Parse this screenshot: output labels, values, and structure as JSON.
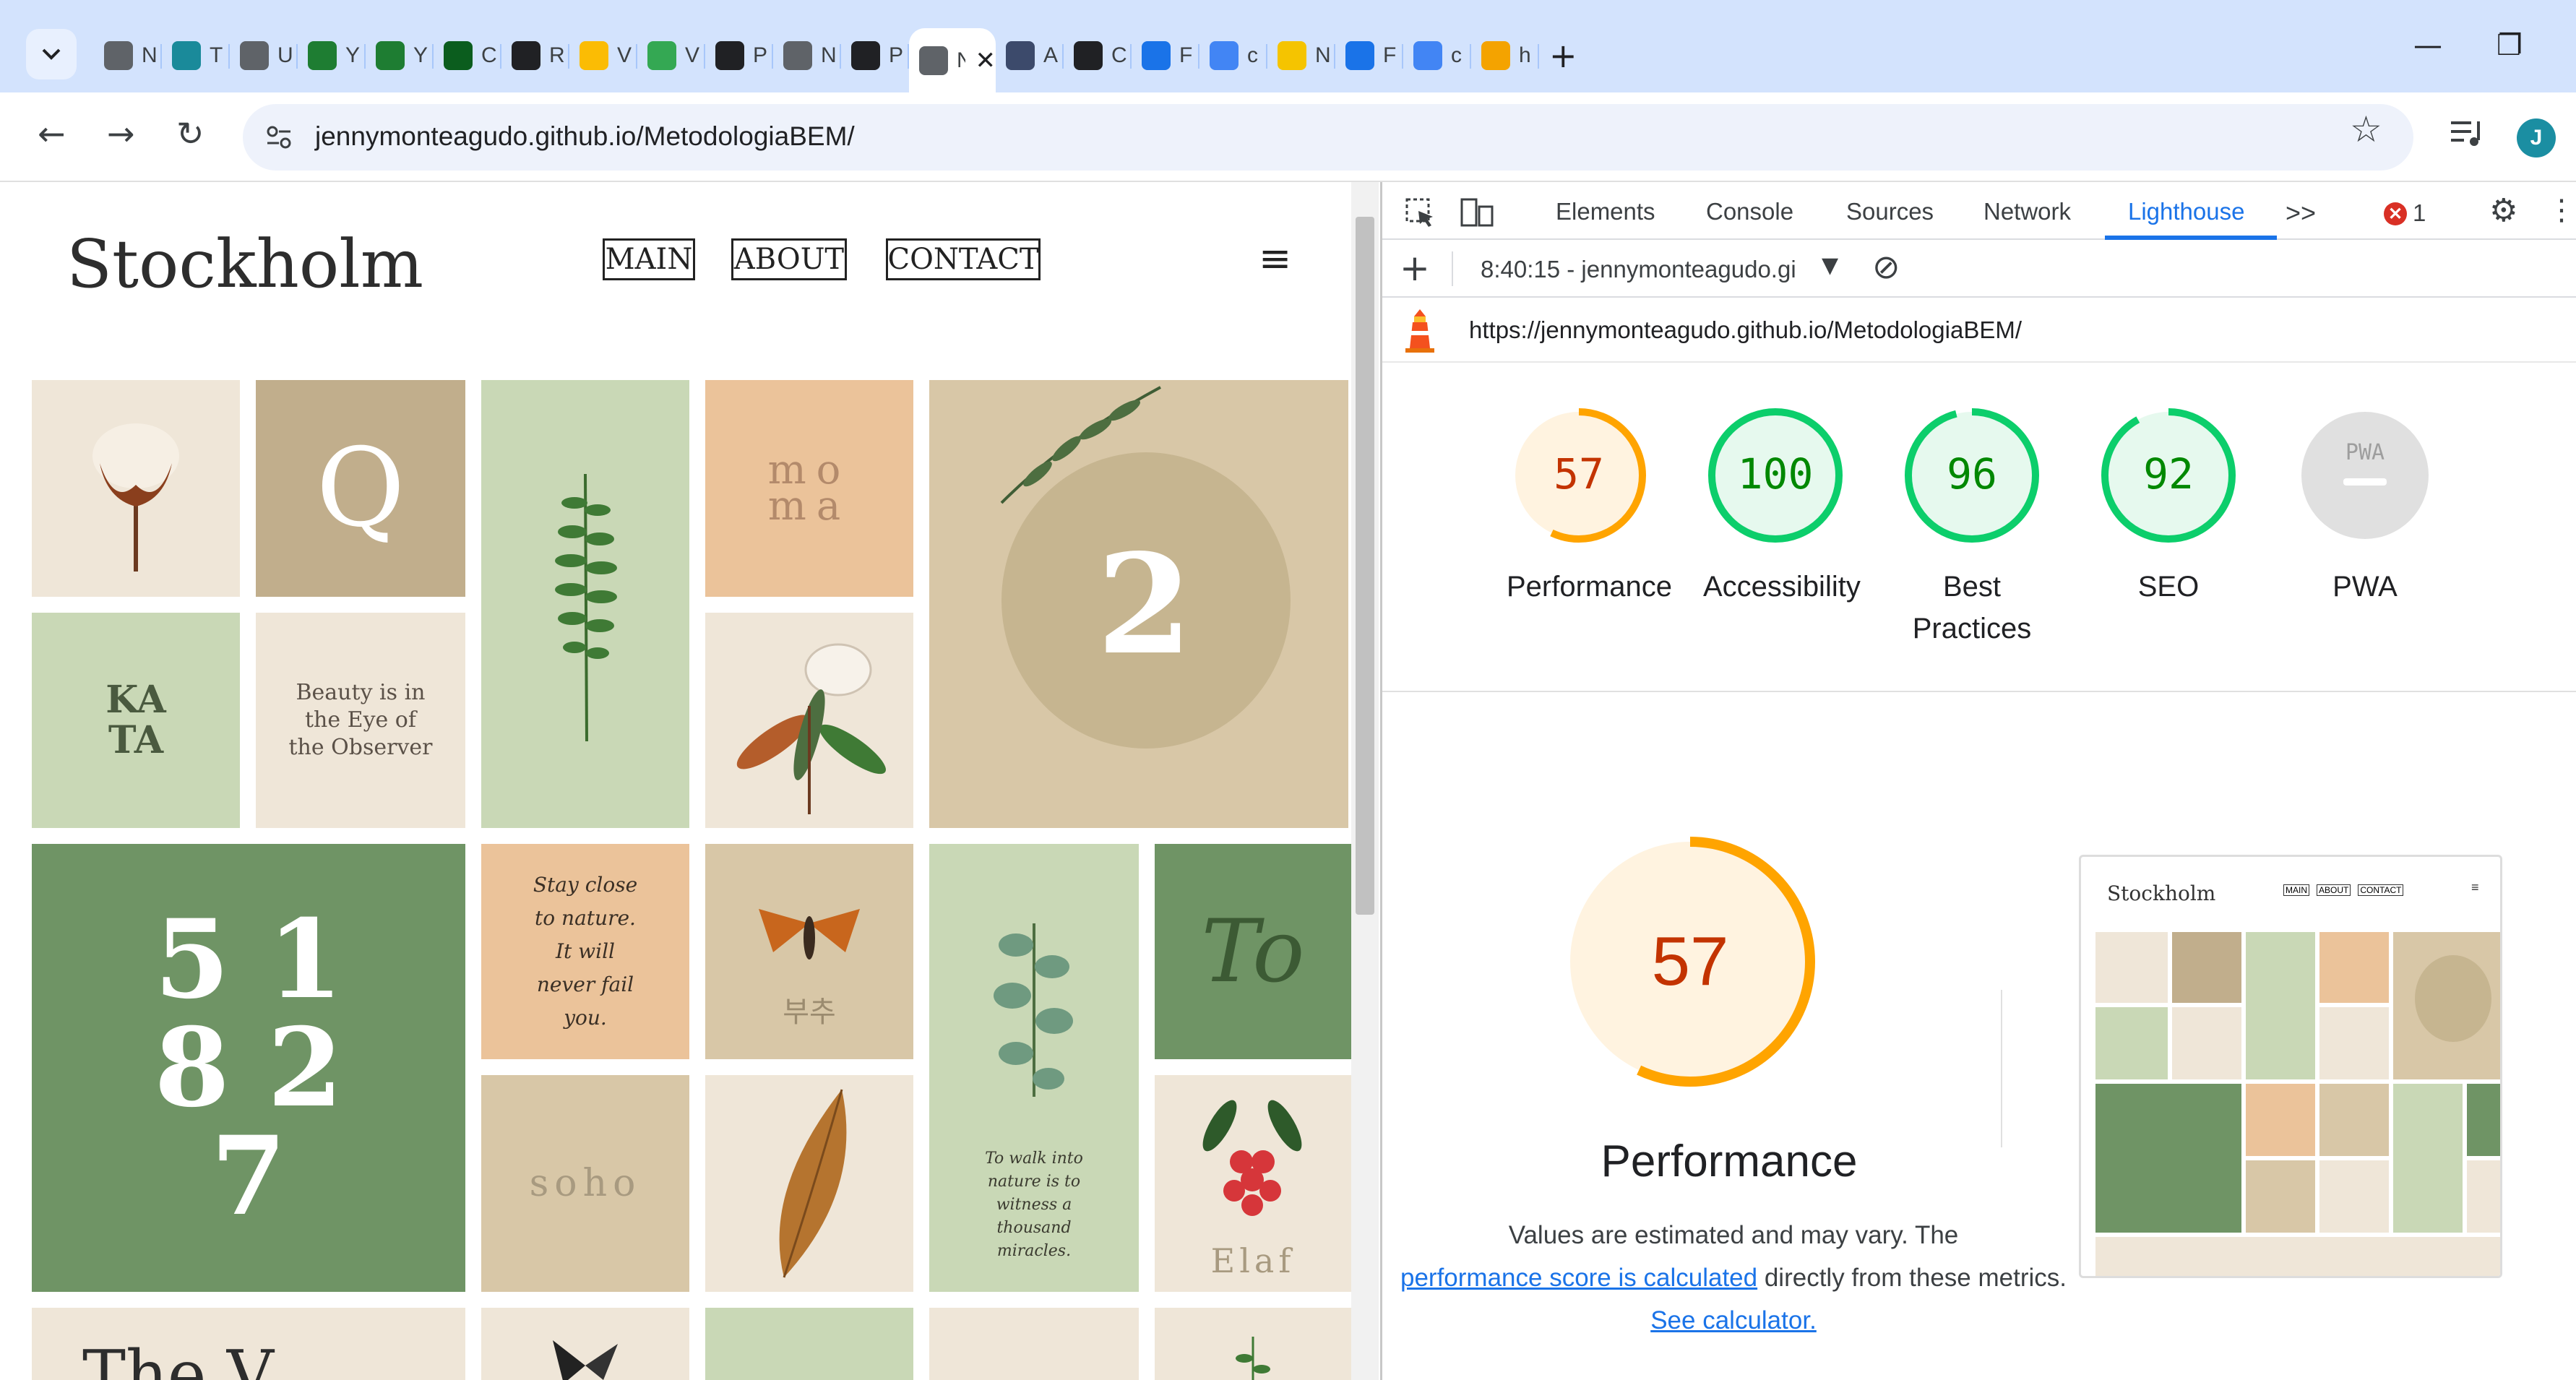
{
  "browser": {
    "tabs": [
      {
        "icon": "globe-icon",
        "title": "N",
        "color": "#5f6368"
      },
      {
        "icon": "teams-icon",
        "title": "T",
        "color": "#1a8a9a"
      },
      {
        "icon": "circle-icon",
        "title": "U",
        "color": "#5f6368"
      },
      {
        "icon": "flask-icon",
        "title": "Y",
        "color": "#1e7d32"
      },
      {
        "icon": "flask-icon",
        "title": "Y",
        "color": "#1e7d32"
      },
      {
        "icon": "w-icon",
        "title": "C",
        "color": "#0b5d1e"
      },
      {
        "icon": "dice-icon",
        "title": "R",
        "color": "#202124"
      },
      {
        "icon": "drive-icon",
        "title": "V",
        "color": "#fbbc04"
      },
      {
        "icon": "drive-icon",
        "title": "V",
        "color": "#34a853"
      },
      {
        "icon": "github-icon",
        "title": "P",
        "color": "#202124"
      },
      {
        "icon": "globe-icon",
        "title": "N",
        "color": "#5f6368"
      },
      {
        "icon": "github-icon",
        "title": "P",
        "color": "#202124"
      },
      {
        "icon": "page-icon",
        "title": "N",
        "color": "#5f6368",
        "active": true
      },
      {
        "icon": "compass-icon",
        "title": "A",
        "color": "#3c4a6b"
      },
      {
        "icon": "diamond-icon",
        "title": "C",
        "color": "#202124"
      },
      {
        "icon": "flag-icon",
        "title": "F",
        "color": "#1a73e8"
      },
      {
        "icon": "google-icon",
        "title": "c",
        "color": "#4285f4"
      },
      {
        "icon": "coin-icon",
        "title": "N",
        "color": "#f5c400"
      },
      {
        "icon": "flag-icon",
        "title": "F",
        "color": "#1a73e8"
      },
      {
        "icon": "google-icon",
        "title": "c",
        "color": "#4285f4"
      },
      {
        "icon": "stack-icon",
        "title": "h",
        "color": "#f4a300"
      }
    ],
    "new_tab": "+",
    "url": "jennymonteagudo.github.io/MetodologiaBEM/",
    "avatar_initial": "J"
  },
  "site": {
    "brand": "Stockholm",
    "nav": [
      "MAIN",
      "ABOUT",
      "CONTACT"
    ],
    "tiles": {
      "q": "Q",
      "moma": "mo ma",
      "kata": "KA TA",
      "beauty": "Beauty is in the Eye of the Observer",
      "two": "2",
      "big_number": "5 1 8 2 7",
      "stay": "Stay close to nature. It will never fail you.",
      "soho": "soho",
      "korean": "부추",
      "walk": "To walk into nature is to witness a thousand miracles.",
      "to": "To",
      "elaf": "Elaf",
      "bottom_text": "The V"
    }
  },
  "devtools": {
    "tabs": [
      "Elements",
      "Console",
      "Sources",
      "Network",
      "Lighthouse"
    ],
    "more": ">>",
    "errors": "1",
    "report_time": "8:40:15 - jennymonteagudo.gi",
    "report_url": "https://jennymonteagudo.github.io/MetodologiaBEM/",
    "scores": [
      {
        "label": "Performance",
        "value": "57",
        "fraction": 0.57,
        "color": "#ffa400",
        "bg": "#fff3e0",
        "text": "#c33300"
      },
      {
        "label": "Accessibility",
        "value": "100",
        "fraction": 1.0,
        "color": "#0cce6b",
        "bg": "#e6f9ee",
        "text": "#008800"
      },
      {
        "label": "Best Practices",
        "value": "96",
        "fraction": 0.96,
        "color": "#0cce6b",
        "bg": "#e6f9ee",
        "text": "#008800"
      },
      {
        "label": "SEO",
        "value": "92",
        "fraction": 0.92,
        "color": "#0cce6b",
        "bg": "#e6f9ee",
        "text": "#008800"
      },
      {
        "label": "PWA",
        "value": "PWA",
        "fraction": 0,
        "color": "#ccc",
        "bg": "#e0e0e0",
        "text": "#9e9e9e"
      }
    ],
    "big_score": "57",
    "big_fraction": 0.57,
    "section_title": "Performance",
    "note_before": "Values are estimated and may vary. The",
    "note_link1": "performance score is calculated",
    "note_mid": "directly from these metrics.",
    "note_link2": "See calculator.",
    "thumb": {
      "brand": "Stockholm",
      "nav": [
        "MAIN",
        "ABOUT",
        "CONTACT"
      ]
    }
  }
}
